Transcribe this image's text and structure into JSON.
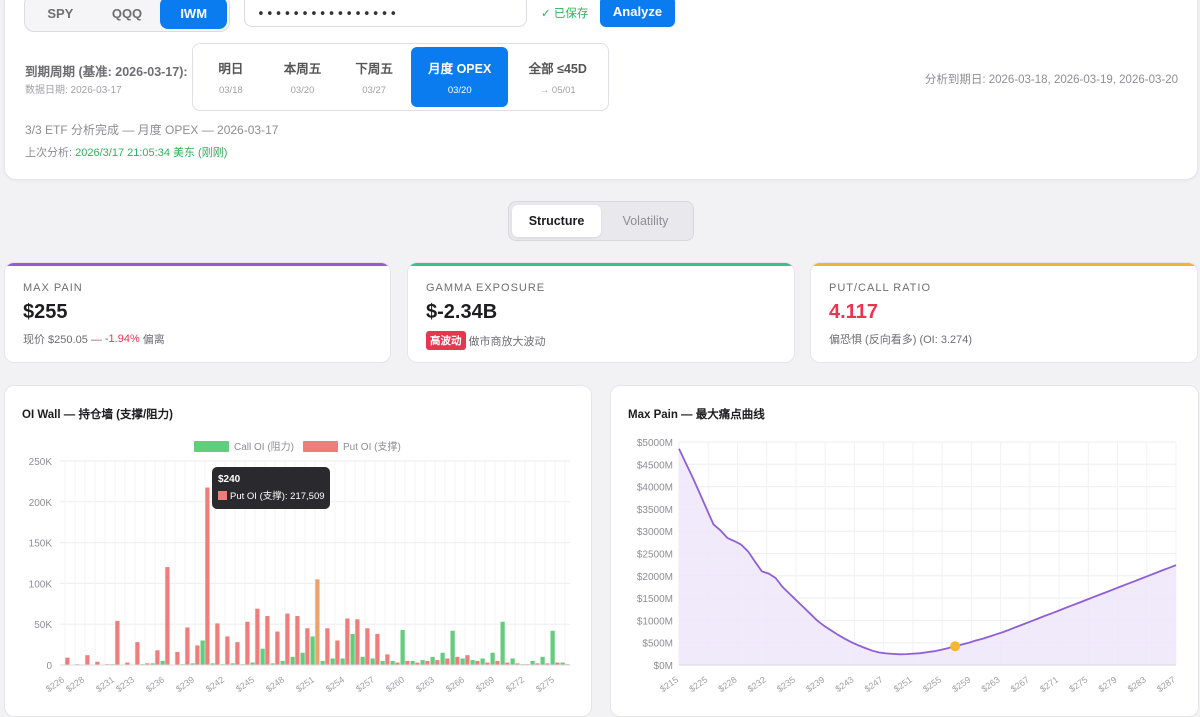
{
  "tickers": [
    {
      "label": "SPY",
      "active": false
    },
    {
      "label": "QQQ",
      "active": false
    },
    {
      "label": "IWM",
      "active": true
    }
  ],
  "api_key": {
    "value": "••••••••••••••••"
  },
  "saved_status": "✓ 已保存",
  "analyze_label": "Analyze",
  "expiry": {
    "label": "到期周期 (基准: 2026-03-17):",
    "data_date": "数据日期: 2026-03-17",
    "options": [
      {
        "label": "明日",
        "date": "03/18",
        "active": false
      },
      {
        "label": "本周五",
        "date": "03/20",
        "active": false
      },
      {
        "label": "下周五",
        "date": "03/27",
        "active": false
      },
      {
        "label": "月度 OPEX",
        "date": "03/20",
        "active": true
      },
      {
        "label": "全部 ≤45D",
        "date": "→ 05/01",
        "active": false
      }
    ],
    "analysis_dates": "分析到期日: 2026-03-18, 2026-03-19, 2026-03-20"
  },
  "status": {
    "complete": "3/3 ETF 分析完成 — 月度 OPEX — 2026-03-17",
    "last_prefix": "上次分析: ",
    "last_time": "2026/3/17 21:05:34 美东 (刚刚)"
  },
  "view_tabs": [
    {
      "label": "Structure",
      "active": true
    },
    {
      "label": "Volatility",
      "active": false
    }
  ],
  "metrics": {
    "max_pain": {
      "label": "MAX PAIN",
      "value": "$255",
      "sub_prefix": "现价 $250.05 — ",
      "sub_change": "-1.94%",
      "sub_suffix": " 偏离",
      "color": "#8e5fd6"
    },
    "gamma": {
      "label": "GAMMA EXPOSURE",
      "value": "$-2.34B",
      "badge": "高波动",
      "sub": "做市商放大波动",
      "color": "#3cc08a"
    },
    "pcr": {
      "label": "PUT/CALL RATIO",
      "value": "4.117",
      "sub": "偏恐惧 (反向看多) (OI: 3.274)",
      "color": "#f2b33a",
      "value_color": "#e8364f"
    }
  },
  "chart_data": [
    {
      "type": "bar",
      "title": "OI Wall — 持仓墙 (支撑/阻力)",
      "legend": [
        "Call OI (阻力)",
        "Put OI (支撑)"
      ],
      "legend_position": "top",
      "colors": {
        "call": "#62cd7c",
        "put": "#f07c7c",
        "highlight": "#f0a06a"
      },
      "ylim": [
        0,
        250000
      ],
      "yticks": [
        "0",
        "50K",
        "100K",
        "150K",
        "200K",
        "250K"
      ],
      "xtick_labels": [
        "$226",
        "$228",
        "$231",
        "$233",
        "$236",
        "$239",
        "$242",
        "$245",
        "$248",
        "$251",
        "$254",
        "$257",
        "$260",
        "$263",
        "$266",
        "$269",
        "$272",
        "$275"
      ],
      "strikes": [
        226,
        227,
        228,
        229,
        230,
        231,
        232,
        233,
        234,
        235,
        236,
        237,
        238,
        239,
        240,
        241,
        242,
        243,
        244,
        245,
        246,
        247,
        248,
        249,
        250,
        251,
        252,
        253,
        254,
        255,
        256,
        257,
        258,
        259,
        260,
        261,
        262,
        263,
        264,
        265,
        266,
        267,
        268,
        269,
        270,
        271,
        272,
        273,
        274,
        275,
        276
      ],
      "call_oi": [
        0,
        0,
        0,
        0,
        0,
        1000,
        0,
        0,
        1000,
        2000,
        5000,
        0,
        1000,
        2000,
        30000,
        2000,
        1000,
        2000,
        1000,
        3000,
        20000,
        2000,
        5000,
        10000,
        15000,
        35000,
        5000,
        8000,
        8000,
        38000,
        10000,
        8000,
        5000,
        5000,
        43000,
        5000,
        6000,
        10000,
        15000,
        42000,
        8000,
        6000,
        8000,
        15000,
        53000,
        8000,
        1000,
        5000,
        10000,
        42000,
        3000
      ],
      "put_oi": [
        9000,
        1000,
        12000,
        4000,
        1000,
        54000,
        3000,
        28000,
        2000,
        18000,
        120000,
        16000,
        46000,
        24000,
        217509,
        51000,
        35000,
        28000,
        53000,
        69000,
        60000,
        41000,
        63000,
        60000,
        45000,
        105000,
        45000,
        30000,
        57000,
        56000,
        45000,
        38000,
        13000,
        3000,
        5000,
        3000,
        5000,
        6000,
        8000,
        10000,
        12000,
        5000,
        3000,
        5000,
        3000,
        2000,
        1000,
        2000,
        2000,
        3000,
        1000
      ],
      "highlight_strike": 251,
      "tooltip": {
        "title": "$240",
        "text": "Put OI (支撑): 217,509"
      }
    },
    {
      "type": "area",
      "title": "Max Pain — 最大痛点曲线",
      "ylim": [
        0,
        5000
      ],
      "yticks": [
        "$0M",
        "$500M",
        "$1000M",
        "$1500M",
        "$2000M",
        "$2500M",
        "$3000M",
        "$3500M",
        "$4000M",
        "$4500M",
        "$5000M"
      ],
      "xlim": [
        215,
        287
      ],
      "xtick_labels": [
        "$215",
        "$225",
        "$228",
        "$232",
        "$235",
        "$239",
        "$243",
        "$247",
        "$251",
        "$255",
        "$259",
        "$263",
        "$267",
        "$271",
        "$275",
        "$279",
        "$283",
        "$287"
      ],
      "x": [
        215,
        216,
        217,
        218,
        219,
        220,
        221,
        222,
        223,
        224,
        225,
        226,
        227,
        228,
        229,
        230,
        231,
        232,
        233,
        234,
        235,
        236,
        237,
        238,
        239,
        240,
        241,
        242,
        243,
        244,
        245,
        246,
        247,
        248,
        249,
        250,
        251,
        252,
        253,
        254,
        255,
        256,
        257,
        258,
        259,
        260,
        261,
        262,
        263,
        264,
        265,
        266,
        267,
        268,
        269,
        270,
        271,
        272,
        273,
        274,
        275,
        276,
        277,
        278,
        279,
        280,
        281,
        282,
        283,
        284,
        285,
        286,
        287
      ],
      "y": [
        4850,
        4520,
        4200,
        3850,
        3500,
        3150,
        3020,
        2850,
        2780,
        2700,
        2550,
        2320,
        2100,
        2050,
        1950,
        1750,
        1600,
        1450,
        1300,
        1150,
        1000,
        880,
        780,
        680,
        590,
        510,
        440,
        380,
        320,
        280,
        260,
        250,
        240,
        245,
        255,
        265,
        290,
        310,
        340,
        380,
        420,
        460,
        500,
        550,
        590,
        640,
        690,
        740,
        800,
        860,
        920,
        980,
        1040,
        1100,
        1160,
        1220,
        1280,
        1340,
        1400,
        1460,
        1520,
        1580,
        1640,
        1700,
        1760,
        1820,
        1880,
        1940,
        2000,
        2060,
        2120,
        2180,
        2240
      ],
      "max_pain_strike": 255,
      "line_color": "#8e5fd6",
      "fill_color": "#eee6fa",
      "marker_color": "#f5b82e"
    }
  ]
}
